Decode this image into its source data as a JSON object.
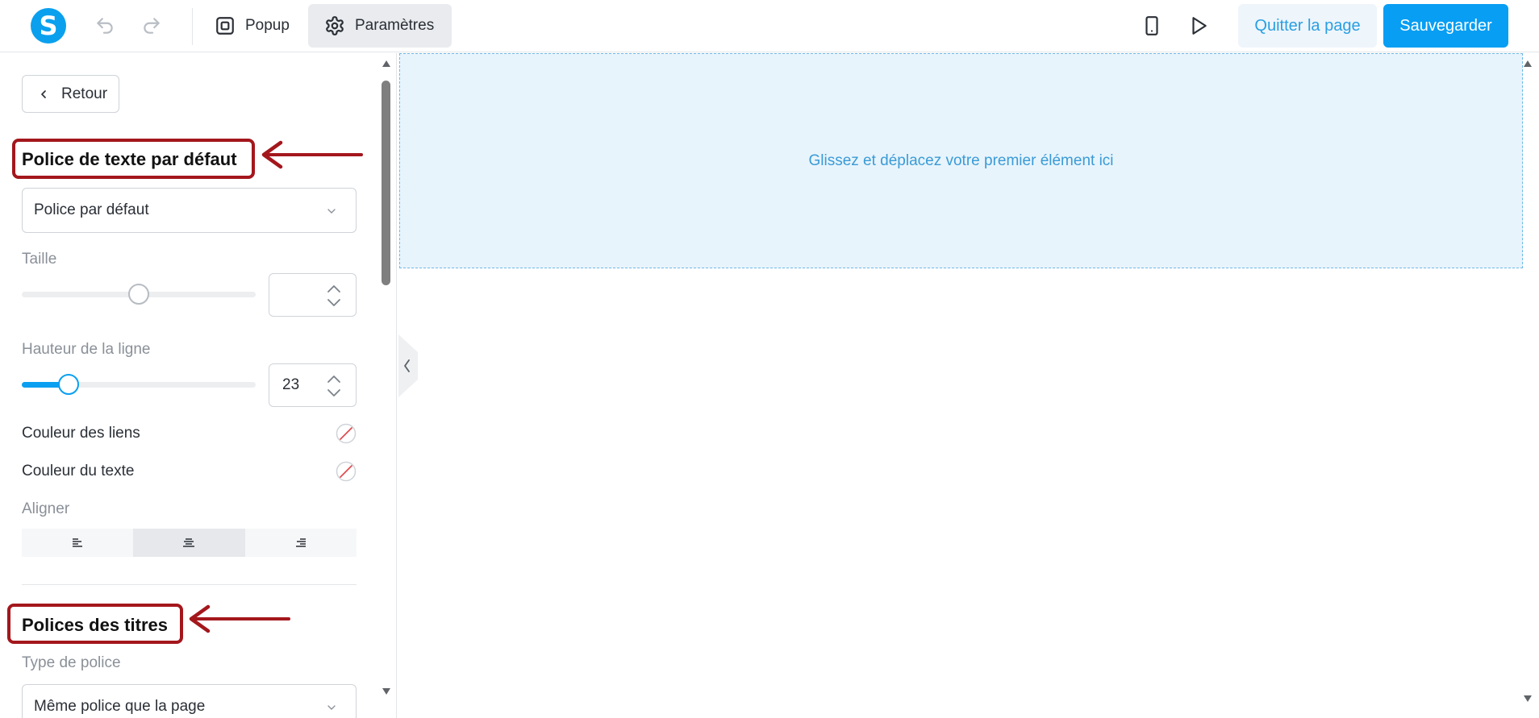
{
  "app": {
    "logo_letter": "S",
    "accent_color": "#079ef3",
    "annotation_color": "#a3171c"
  },
  "toolbar": {
    "undo_icon": "undo-icon",
    "redo_icon": "redo-icon",
    "tab_popup": "Popup",
    "tab_settings": "Paramètres",
    "device_icon": "mobile-device-icon",
    "preview_icon": "play-icon",
    "quit_label": "Quitter la page",
    "save_label": "Sauvegarder"
  },
  "panel": {
    "back_label": "Retour",
    "default_font_title": "Police de texte par défaut",
    "default_font_value": "Police par défaut",
    "size_label": "Taille",
    "size_value": "",
    "size_slider_fraction": 0.5,
    "line_height_label": "Hauteur de la ligne",
    "line_height_value": "23",
    "line_height_slider_fraction": 0.2,
    "link_color_label": "Couleur des liens",
    "text_color_label": "Couleur du texte",
    "align_label": "Aligner",
    "align_options": [
      "left",
      "center",
      "right"
    ],
    "align_selected": "center",
    "headings_title": "Polices des titres",
    "font_type_label": "Type de police",
    "font_type_value": "Même police que la page"
  },
  "canvas": {
    "drop_text": "Glissez et déplacez votre premier élément ici"
  }
}
